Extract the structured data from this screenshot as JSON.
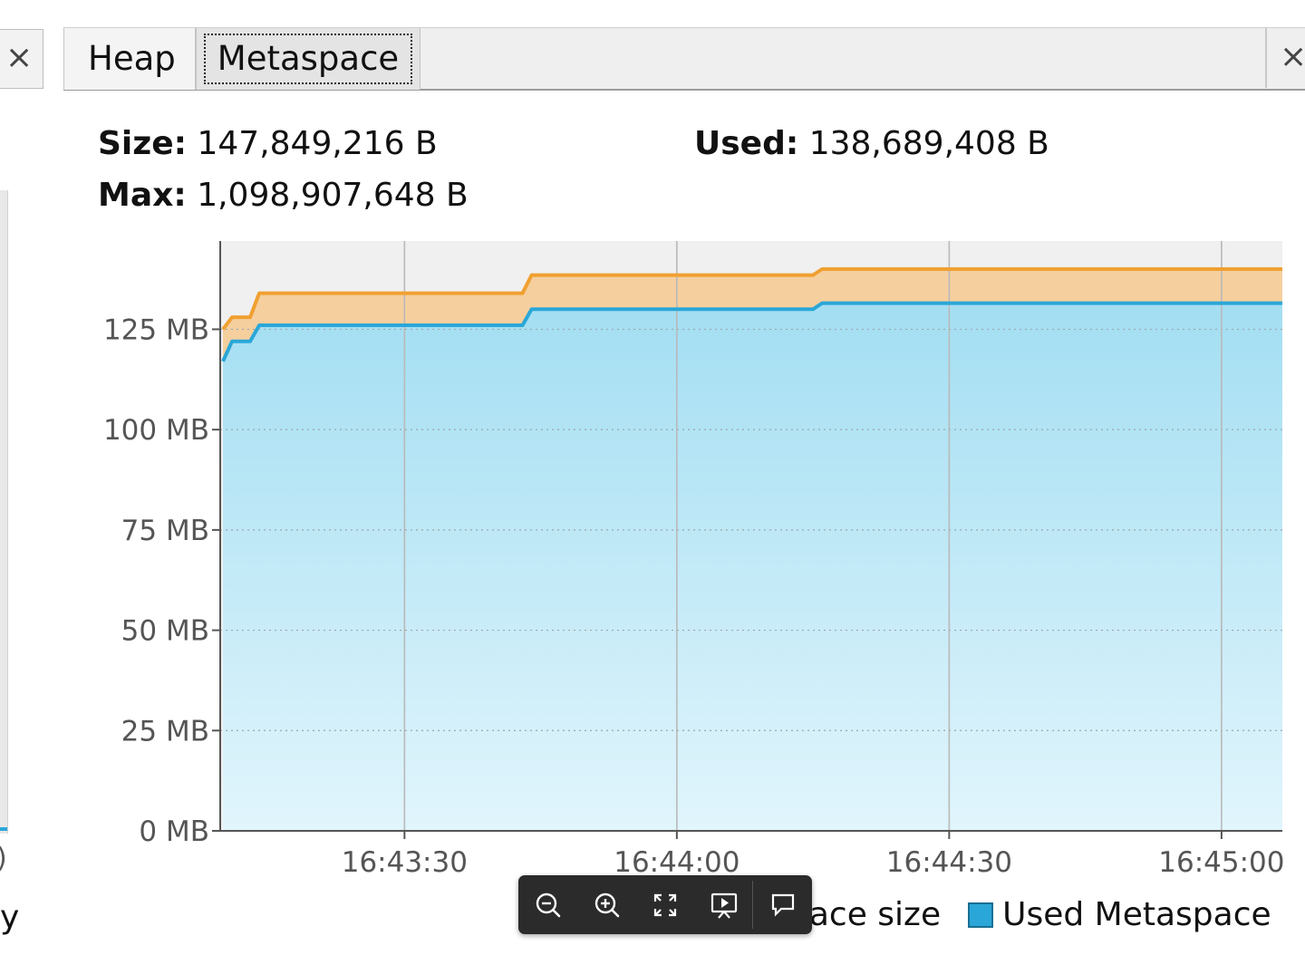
{
  "left_panel": {
    "close_glyph": "×",
    "tick_fragment": ")",
    "label_fragment": "y"
  },
  "tabs": [
    {
      "label": "Heap",
      "active": false
    },
    {
      "label": "Metaspace",
      "active": true
    }
  ],
  "close_glyph": "×",
  "stats": {
    "size_label": "Size:",
    "size_value": "147,849,216 B",
    "used_label": "Used:",
    "used_value": "138,689,408 B",
    "max_label": "Max:",
    "max_value": "1,098,907,648 B"
  },
  "legend": {
    "metaspace_size_fragment": "pace size",
    "used_metaspace": "Used Metaspace"
  },
  "toolbar": {
    "icons": [
      "zoom-out-icon",
      "zoom-in-icon",
      "fullscreen-icon",
      "present-icon",
      "comment-icon"
    ]
  },
  "colors": {
    "size_line": "#f0a030",
    "size_fill": "#f5cf9e",
    "used_line": "#2aa7d8",
    "used_fill_top": "#a3def2",
    "used_fill_bottom": "#e1f5fc",
    "plot_bg": "#f0f0f0"
  },
  "chart_data": {
    "type": "area",
    "x_unit": "time",
    "x_ticks": [
      "16:43:30",
      "16:44:00",
      "16:44:30",
      "16:45:00"
    ],
    "xlim": [
      "16:43:09.7",
      "16:45:06.7"
    ],
    "y_ticks": [
      "0 MB",
      "25 MB",
      "50 MB",
      "75 MB",
      "100 MB",
      "125 MB"
    ],
    "y_tick_values": [
      0,
      25,
      50,
      75,
      100,
      125
    ],
    "ylim": [
      0,
      147
    ],
    "y_unit": "MB",
    "grid": true,
    "legend_position": "bottom",
    "series": [
      {
        "name": "Metaspace size",
        "x": [
          "16:43:10",
          "16:43:11",
          "16:43:12",
          "16:43:13",
          "16:43:14",
          "16:43:43",
          "16:43:44",
          "16:44:15",
          "16:44:16",
          "16:45:06.7"
        ],
        "values": [
          125,
          128,
          128,
          128,
          134,
          134,
          138.5,
          138.5,
          140,
          140
        ]
      },
      {
        "name": "Used Metaspace",
        "x": [
          "16:43:10",
          "16:43:11",
          "16:43:12",
          "16:43:13",
          "16:43:14",
          "16:43:43",
          "16:43:44",
          "16:44:15",
          "16:44:16",
          "16:45:06.7"
        ],
        "values": [
          117,
          122,
          122,
          122,
          126,
          126,
          130,
          130,
          131.5,
          131.5
        ]
      }
    ]
  }
}
